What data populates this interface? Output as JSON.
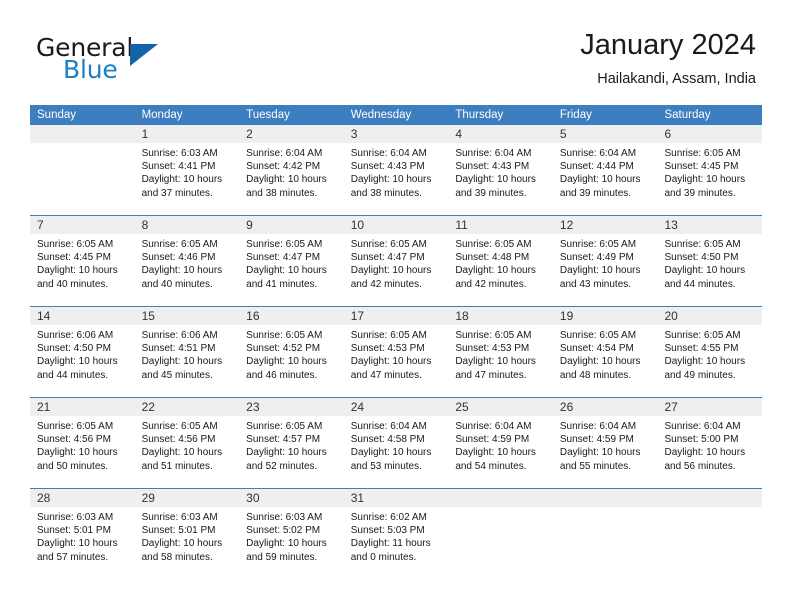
{
  "brand": {
    "name_part1": "General",
    "name_part2": "Blue",
    "triangle_color": "#1263a8",
    "blue_color": "#1f7fc4"
  },
  "header": {
    "title": "January 2024",
    "location": "Hailakandi, Assam, India"
  },
  "theme": {
    "header_bar_color": "#3c7ebf",
    "day_number_bg": "#efefef",
    "text_color": "#1a1a1a"
  },
  "weekdays": [
    "Sunday",
    "Monday",
    "Tuesday",
    "Wednesday",
    "Thursday",
    "Friday",
    "Saturday"
  ],
  "weeks": [
    [
      {
        "day": "",
        "sunrise": "",
        "sunset": "",
        "daylight_line1": "",
        "daylight_line2": ""
      },
      {
        "day": "1",
        "sunrise": "Sunrise: 6:03 AM",
        "sunset": "Sunset: 4:41 PM",
        "daylight_line1": "Daylight: 10 hours",
        "daylight_line2": "and 37 minutes."
      },
      {
        "day": "2",
        "sunrise": "Sunrise: 6:04 AM",
        "sunset": "Sunset: 4:42 PM",
        "daylight_line1": "Daylight: 10 hours",
        "daylight_line2": "and 38 minutes."
      },
      {
        "day": "3",
        "sunrise": "Sunrise: 6:04 AM",
        "sunset": "Sunset: 4:43 PM",
        "daylight_line1": "Daylight: 10 hours",
        "daylight_line2": "and 38 minutes."
      },
      {
        "day": "4",
        "sunrise": "Sunrise: 6:04 AM",
        "sunset": "Sunset: 4:43 PM",
        "daylight_line1": "Daylight: 10 hours",
        "daylight_line2": "and 39 minutes."
      },
      {
        "day": "5",
        "sunrise": "Sunrise: 6:04 AM",
        "sunset": "Sunset: 4:44 PM",
        "daylight_line1": "Daylight: 10 hours",
        "daylight_line2": "and 39 minutes."
      },
      {
        "day": "6",
        "sunrise": "Sunrise: 6:05 AM",
        "sunset": "Sunset: 4:45 PM",
        "daylight_line1": "Daylight: 10 hours",
        "daylight_line2": "and 39 minutes."
      }
    ],
    [
      {
        "day": "7",
        "sunrise": "Sunrise: 6:05 AM",
        "sunset": "Sunset: 4:45 PM",
        "daylight_line1": "Daylight: 10 hours",
        "daylight_line2": "and 40 minutes."
      },
      {
        "day": "8",
        "sunrise": "Sunrise: 6:05 AM",
        "sunset": "Sunset: 4:46 PM",
        "daylight_line1": "Daylight: 10 hours",
        "daylight_line2": "and 40 minutes."
      },
      {
        "day": "9",
        "sunrise": "Sunrise: 6:05 AM",
        "sunset": "Sunset: 4:47 PM",
        "daylight_line1": "Daylight: 10 hours",
        "daylight_line2": "and 41 minutes."
      },
      {
        "day": "10",
        "sunrise": "Sunrise: 6:05 AM",
        "sunset": "Sunset: 4:47 PM",
        "daylight_line1": "Daylight: 10 hours",
        "daylight_line2": "and 42 minutes."
      },
      {
        "day": "11",
        "sunrise": "Sunrise: 6:05 AM",
        "sunset": "Sunset: 4:48 PM",
        "daylight_line1": "Daylight: 10 hours",
        "daylight_line2": "and 42 minutes."
      },
      {
        "day": "12",
        "sunrise": "Sunrise: 6:05 AM",
        "sunset": "Sunset: 4:49 PM",
        "daylight_line1": "Daylight: 10 hours",
        "daylight_line2": "and 43 minutes."
      },
      {
        "day": "13",
        "sunrise": "Sunrise: 6:05 AM",
        "sunset": "Sunset: 4:50 PM",
        "daylight_line1": "Daylight: 10 hours",
        "daylight_line2": "and 44 minutes."
      }
    ],
    [
      {
        "day": "14",
        "sunrise": "Sunrise: 6:06 AM",
        "sunset": "Sunset: 4:50 PM",
        "daylight_line1": "Daylight: 10 hours",
        "daylight_line2": "and 44 minutes."
      },
      {
        "day": "15",
        "sunrise": "Sunrise: 6:06 AM",
        "sunset": "Sunset: 4:51 PM",
        "daylight_line1": "Daylight: 10 hours",
        "daylight_line2": "and 45 minutes."
      },
      {
        "day": "16",
        "sunrise": "Sunrise: 6:05 AM",
        "sunset": "Sunset: 4:52 PM",
        "daylight_line1": "Daylight: 10 hours",
        "daylight_line2": "and 46 minutes."
      },
      {
        "day": "17",
        "sunrise": "Sunrise: 6:05 AM",
        "sunset": "Sunset: 4:53 PM",
        "daylight_line1": "Daylight: 10 hours",
        "daylight_line2": "and 47 minutes."
      },
      {
        "day": "18",
        "sunrise": "Sunrise: 6:05 AM",
        "sunset": "Sunset: 4:53 PM",
        "daylight_line1": "Daylight: 10 hours",
        "daylight_line2": "and 47 minutes."
      },
      {
        "day": "19",
        "sunrise": "Sunrise: 6:05 AM",
        "sunset": "Sunset: 4:54 PM",
        "daylight_line1": "Daylight: 10 hours",
        "daylight_line2": "and 48 minutes."
      },
      {
        "day": "20",
        "sunrise": "Sunrise: 6:05 AM",
        "sunset": "Sunset: 4:55 PM",
        "daylight_line1": "Daylight: 10 hours",
        "daylight_line2": "and 49 minutes."
      }
    ],
    [
      {
        "day": "21",
        "sunrise": "Sunrise: 6:05 AM",
        "sunset": "Sunset: 4:56 PM",
        "daylight_line1": "Daylight: 10 hours",
        "daylight_line2": "and 50 minutes."
      },
      {
        "day": "22",
        "sunrise": "Sunrise: 6:05 AM",
        "sunset": "Sunset: 4:56 PM",
        "daylight_line1": "Daylight: 10 hours",
        "daylight_line2": "and 51 minutes."
      },
      {
        "day": "23",
        "sunrise": "Sunrise: 6:05 AM",
        "sunset": "Sunset: 4:57 PM",
        "daylight_line1": "Daylight: 10 hours",
        "daylight_line2": "and 52 minutes."
      },
      {
        "day": "24",
        "sunrise": "Sunrise: 6:04 AM",
        "sunset": "Sunset: 4:58 PM",
        "daylight_line1": "Daylight: 10 hours",
        "daylight_line2": "and 53 minutes."
      },
      {
        "day": "25",
        "sunrise": "Sunrise: 6:04 AM",
        "sunset": "Sunset: 4:59 PM",
        "daylight_line1": "Daylight: 10 hours",
        "daylight_line2": "and 54 minutes."
      },
      {
        "day": "26",
        "sunrise": "Sunrise: 6:04 AM",
        "sunset": "Sunset: 4:59 PM",
        "daylight_line1": "Daylight: 10 hours",
        "daylight_line2": "and 55 minutes."
      },
      {
        "day": "27",
        "sunrise": "Sunrise: 6:04 AM",
        "sunset": "Sunset: 5:00 PM",
        "daylight_line1": "Daylight: 10 hours",
        "daylight_line2": "and 56 minutes."
      }
    ],
    [
      {
        "day": "28",
        "sunrise": "Sunrise: 6:03 AM",
        "sunset": "Sunset: 5:01 PM",
        "daylight_line1": "Daylight: 10 hours",
        "daylight_line2": "and 57 minutes."
      },
      {
        "day": "29",
        "sunrise": "Sunrise: 6:03 AM",
        "sunset": "Sunset: 5:01 PM",
        "daylight_line1": "Daylight: 10 hours",
        "daylight_line2": "and 58 minutes."
      },
      {
        "day": "30",
        "sunrise": "Sunrise: 6:03 AM",
        "sunset": "Sunset: 5:02 PM",
        "daylight_line1": "Daylight: 10 hours",
        "daylight_line2": "and 59 minutes."
      },
      {
        "day": "31",
        "sunrise": "Sunrise: 6:02 AM",
        "sunset": "Sunset: 5:03 PM",
        "daylight_line1": "Daylight: 11 hours",
        "daylight_line2": "and 0 minutes."
      },
      {
        "day": "",
        "sunrise": "",
        "sunset": "",
        "daylight_line1": "",
        "daylight_line2": ""
      },
      {
        "day": "",
        "sunrise": "",
        "sunset": "",
        "daylight_line1": "",
        "daylight_line2": ""
      },
      {
        "day": "",
        "sunrise": "",
        "sunset": "",
        "daylight_line1": "",
        "daylight_line2": ""
      }
    ]
  ]
}
